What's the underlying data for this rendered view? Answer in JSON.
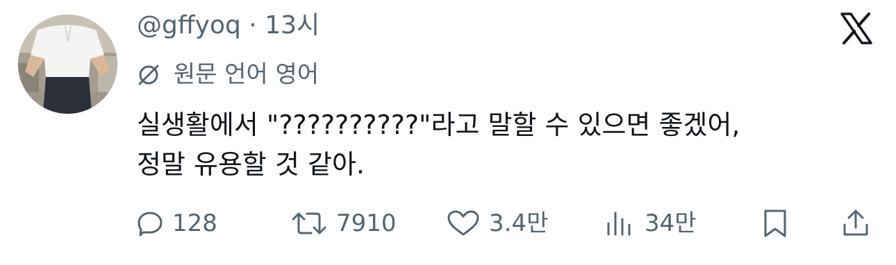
{
  "tweet": {
    "handle": "@gffyoq",
    "separator": "·",
    "time": "13시",
    "translate_label": "원문 언어 영어",
    "text": "실생활에서 \"??????????\"라고 말할 수 있으면 좋겠어,\n정말 유용할 것 같아.",
    "stats": {
      "replies": "128",
      "retweets": "7910",
      "likes": "3.4만",
      "views": "34만"
    }
  },
  "icons": {
    "platform": "x-logo-icon",
    "translate": "globe-slash-icon",
    "reply": "speech-bubble-icon",
    "retweet": "retweet-icon",
    "like": "heart-icon",
    "views": "bar-chart-icon",
    "bookmark": "bookmark-icon",
    "share": "share-icon"
  },
  "colors": {
    "text": "#0f1419",
    "secondary": "#536471",
    "background": "#ffffff"
  }
}
